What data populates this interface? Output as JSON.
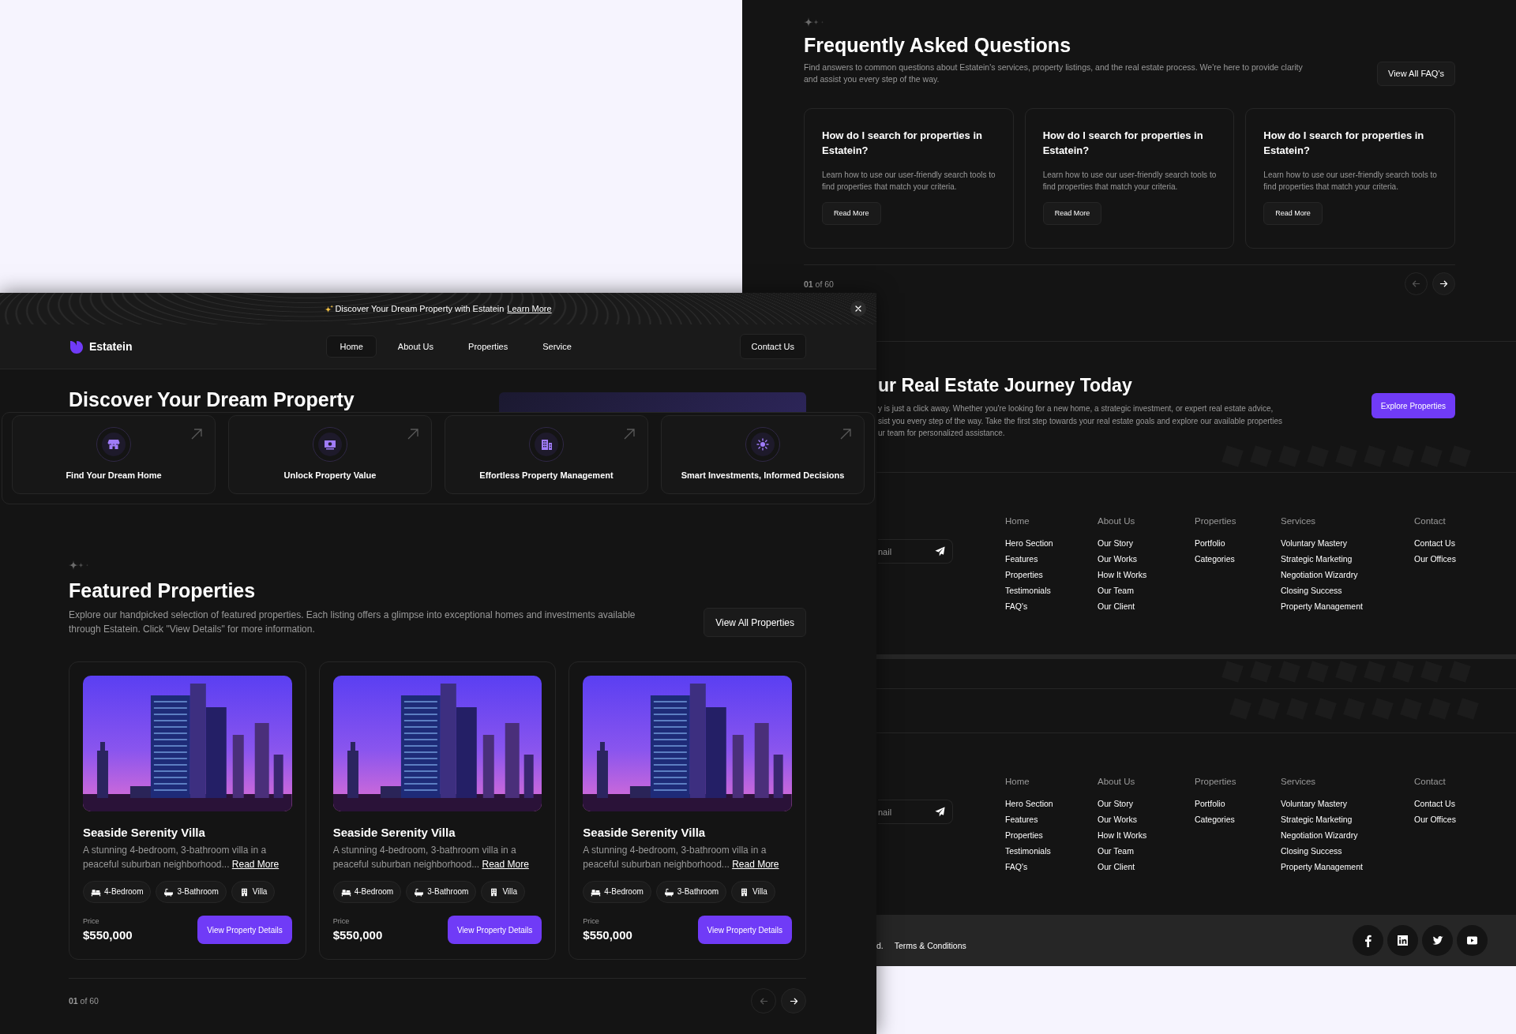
{
  "back_page": {
    "faq": {
      "heading": "Frequently Asked Questions",
      "description": "Find answers to common questions about Estatein's services, property listings, and the real estate process. We're here to provide clarity and assist you every step of the way.",
      "view_all_button": "View All FAQ's",
      "cards": [
        {
          "question": "How do I search for properties in Estatein?",
          "answer": "Learn how to use our user-friendly search tools to find properties that match your criteria.",
          "button": "Read More"
        },
        {
          "question": "How do I search for properties in Estatein?",
          "answer": "Learn how to use our user-friendly search tools to find properties that match your criteria.",
          "button": "Read More"
        },
        {
          "question": "How do I search for properties in Estatein?",
          "answer": "Learn how to use our user-friendly search tools to find properties that match your criteria.",
          "button": "Read More"
        }
      ],
      "pagination": {
        "counter": "**01** of 60",
        "previous": {
          "disabled": true
        },
        "next": {
          "disabled": false
        }
      }
    },
    "cta": {
      "heading": "ur Real Estate Journey Today",
      "lines": [
        "y is just a click away. Whether you're looking for a new home, a strategic investment, or expert real estate advice,",
        "sist you every step of the way. Take the first step towards your real estate goals and explore our available properties",
        "ur team for personalized assistance."
      ],
      "button": "Explore Properties"
    },
    "footers": [
      {
        "email_field": {
          "placeholder": "nail"
        },
        "columns": [
          {
            "heading": "Home",
            "links": [
              "Hero Section",
              "Features",
              "Properties",
              "Testimonials",
              "FAQ's"
            ]
          },
          {
            "heading": "About Us",
            "links": [
              "Our Story",
              "Our Works",
              "How It Works",
              "Our Team",
              "Our Client"
            ]
          },
          {
            "heading": "Properties",
            "links": [
              "Portfolio",
              "Categories"
            ]
          },
          {
            "heading": "Services",
            "links": [
              "Voluntary Mastery",
              "Strategic Marketing",
              "Negotiation Wizardry",
              "Closing Success",
              "Property Management"
            ]
          },
          {
            "heading": "Contact",
            "links": [
              "Contact Us",
              "Our Offices"
            ]
          }
        ]
      },
      {
        "email_field": {
          "placeholder": "nail"
        },
        "columns": [
          {
            "heading": "Home",
            "links": [
              "Hero Section",
              "Features",
              "Properties",
              "Testimonials",
              "FAQ's"
            ]
          },
          {
            "heading": "About Us",
            "links": [
              "Our Story",
              "Our Works",
              "How It Works",
              "Our Team",
              "Our Client"
            ]
          },
          {
            "heading": "Properties",
            "links": [
              "Portfolio",
              "Categories"
            ]
          },
          {
            "heading": "Services",
            "links": [
              "Voluntary Mastery",
              "Strategic Marketing",
              "Negotiation Wizardry",
              "Closing Success",
              "Property Management"
            ]
          },
          {
            "heading": "Contact",
            "links": [
              "Contact Us",
              "Our Offices"
            ]
          }
        ]
      }
    ],
    "bottom_bar": {
      "copyright": "d.",
      "terms_link": "Terms & Conditions",
      "social": [
        {
          "kind": "facebook"
        },
        {
          "kind": "linkedin"
        },
        {
          "kind": "twitter"
        },
        {
          "kind": "youtube"
        }
      ]
    }
  },
  "front_page": {
    "banner": {
      "text": "Discover Your Dream Property with Estatein",
      "link": "Learn More"
    },
    "nav": {
      "brand": "Estatein",
      "links": [
        {
          "label": "Home",
          "selected": true
        },
        {
          "label": "About Us",
          "selected": false
        },
        {
          "label": "Properties",
          "selected": false
        },
        {
          "label": "Service",
          "selected": false
        }
      ],
      "contact_button": "Contact Us"
    },
    "hero": {
      "heading": "Discover Your Dream Property"
    },
    "features": [
      {
        "kind": "storefront",
        "label": "Find Your Dream Home"
      },
      {
        "kind": "banknote",
        "label": "Unlock Property Value"
      },
      {
        "kind": "buildings",
        "label": "Effortless Property Management"
      },
      {
        "kind": "sun",
        "label": "Smart Investments, Informed Decisions"
      }
    ],
    "featured": {
      "heading": "Featured Properties",
      "description": "Explore our handpicked selection of featured properties. Each listing offers a glimpse into exceptional homes and investments available through Estatein. Click \"View Details\" for more information.",
      "view_all_button": "View All Properties",
      "cards": [
        {
          "title": "Seaside Serenity Villa",
          "description": "A stunning 4-bedroom, 3-bathroom villa in a peaceful suburban neighborhood...",
          "link": "Read More",
          "tags": [
            {
              "kind": "bed",
              "label": "4-Bedroom"
            },
            {
              "kind": "bath",
              "label": "3-Bathroom"
            },
            {
              "kind": "building",
              "label": "Villa"
            }
          ],
          "price_label": "Price",
          "price": "$550,000",
          "button": "View Property Details"
        },
        {
          "title": "Seaside Serenity Villa",
          "description": "A stunning 4-bedroom, 3-bathroom villa in a peaceful suburban neighborhood...",
          "link": "Read More",
          "tags": [
            {
              "kind": "bed",
              "label": "4-Bedroom"
            },
            {
              "kind": "bath",
              "label": "3-Bathroom"
            },
            {
              "kind": "building",
              "label": "Villa"
            }
          ],
          "price_label": "Price",
          "price": "$550,000",
          "button": "View Property Details"
        },
        {
          "title": "Seaside Serenity Villa",
          "description": "A stunning 4-bedroom, 3-bathroom villa in a peaceful suburban neighborhood...",
          "link": "Read More",
          "tags": [
            {
              "kind": "bed",
              "label": "4-Bedroom"
            },
            {
              "kind": "bath",
              "label": "3-Bathroom"
            },
            {
              "kind": "building",
              "label": "Villa"
            }
          ],
          "price_label": "Price",
          "price": "$550,000",
          "button": "View Property Details"
        }
      ],
      "pagination": {
        "counter": "**01** of 60",
        "previous": {
          "disabled": true
        },
        "next": {
          "disabled": false
        }
      }
    }
  }
}
